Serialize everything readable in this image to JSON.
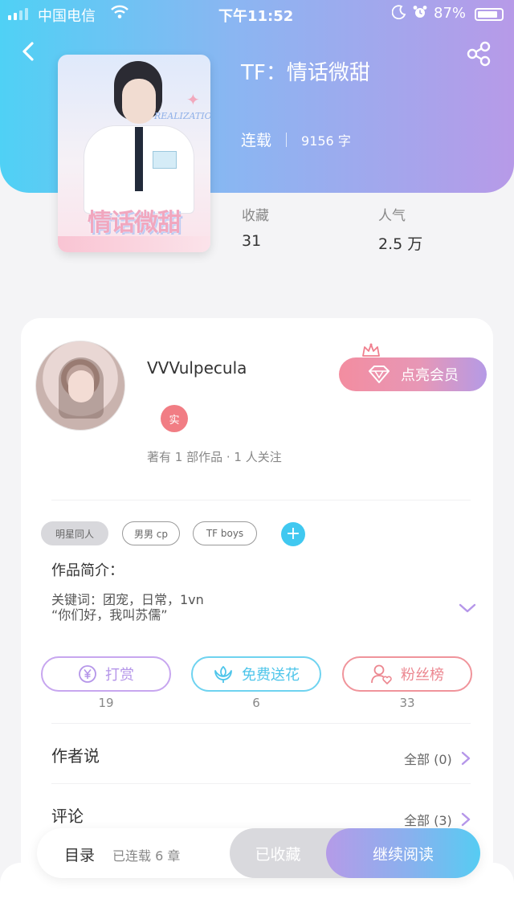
{
  "status_bar": {
    "carrier": "中国电信",
    "time": "下午11:52",
    "battery_percent": "87%",
    "battery_level": 0.87
  },
  "book": {
    "title": "TF：情话微甜",
    "status": "连载",
    "word_count": "9156 字",
    "cover_text": "情话微甜",
    "cover_word": "REALIZATION"
  },
  "stats": {
    "favorites_label": "收藏",
    "favorites_value": "31",
    "popularity_label": "人气",
    "popularity_value": "2.5 万"
  },
  "author": {
    "name": "VVVulpecula",
    "real_badge": "实",
    "info": "著有 1 部作品 · 1 人关注",
    "vip_button": "点亮会员"
  },
  "tags": [
    "明星同人",
    "男男 cp",
    "TF boys"
  ],
  "intro": {
    "title": "作品简介：",
    "line1": "关键词：团宠，日常，1vn",
    "line2": "“你们好，我叫苏儒”"
  },
  "actions": {
    "tip_label": "打赏",
    "tip_count": "19",
    "flower_label": "免费送花",
    "flower_count": "6",
    "fans_label": "粉丝榜",
    "fans_count": "33"
  },
  "author_says": {
    "title": "作者说",
    "link": "全部 (0)"
  },
  "comments": {
    "title": "评论",
    "link": "全部 (3)"
  },
  "bottom_bar": {
    "toc_label": "目录",
    "chapters": "已连载 6 章",
    "collected_label": "已收藏",
    "read_label": "继续阅读"
  },
  "colors": {
    "header_gradient_start": "#4fd1f5",
    "header_gradient_end": "#b79ae8",
    "tip": "#b596e9",
    "flower": "#4ec5ea",
    "fans": "#ec8790",
    "add_tag": "#40c8f0"
  }
}
